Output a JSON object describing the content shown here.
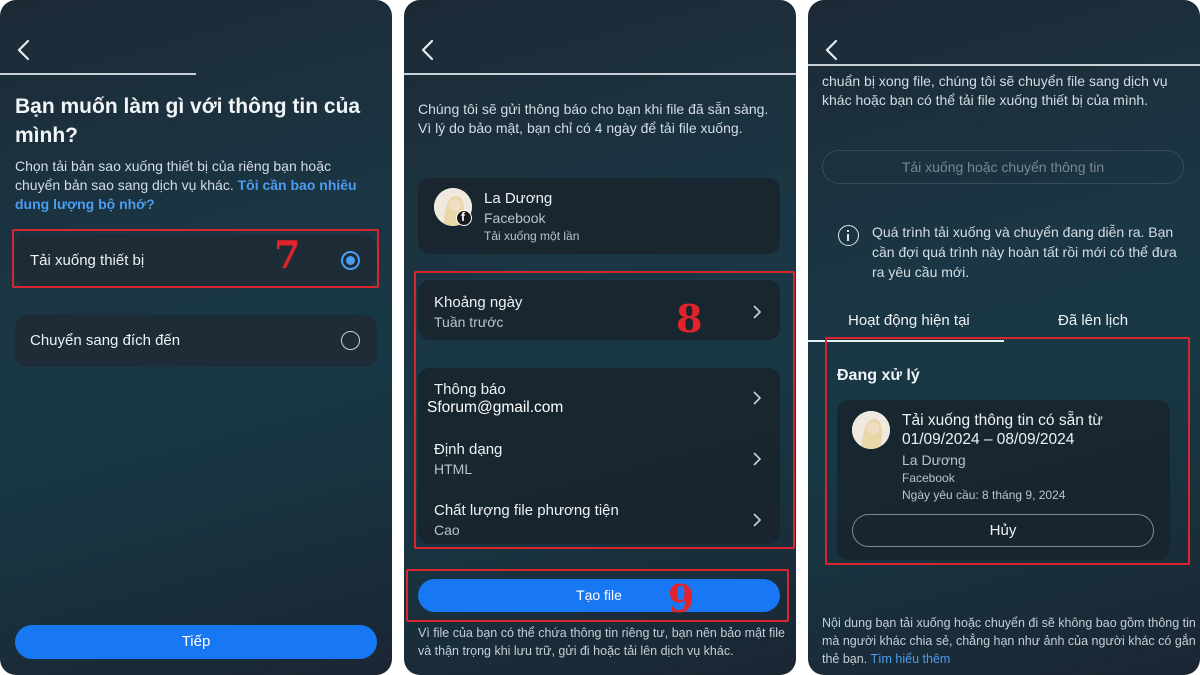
{
  "panel1": {
    "title": "Bạn muốn làm gì với thông tin của mình?",
    "description": "Chọn tải bản sao xuống thiết bị của riêng bạn hoặc chuyển bản sao sang dịch vụ khác.",
    "storage_link": "Tôi cần bao nhiêu dung lượng bộ nhớ?",
    "options": [
      {
        "label": "Tải xuống thiết bị",
        "selected": true
      },
      {
        "label": "Chuyển sang đích đến",
        "selected": false
      }
    ],
    "annotation": "7",
    "next_button": "Tiếp"
  },
  "panel2": {
    "intro": "Chúng tôi sẽ gửi thông báo cho bạn khi file đã sẵn sàng. Vì lý do bảo mật, bạn chỉ có 4 ngày để tải file xuống.",
    "profile": {
      "name": "La Dương",
      "platform": "Facebook",
      "type": "Tải xuống một lần"
    },
    "settings": [
      {
        "title": "Khoảng ngày",
        "value": "Tuần trước"
      },
      {
        "title": "Thông báo",
        "value": "Sforum@gmail.com"
      },
      {
        "title": "Định dạng",
        "value": "HTML"
      },
      {
        "title": "Chất lượng file phương tiện",
        "value": "Cao"
      }
    ],
    "annotation_settings": "8",
    "create_button": "Tạo file",
    "annotation_button": "9",
    "footer": "Vì file của bạn có thể chứa thông tin riêng tư, bạn nên bảo mật file và thận trọng khi lưu trữ, gửi đi hoặc tải lên dịch vụ khác."
  },
  "panel3": {
    "top_text": "chuẩn bị xong file, chúng tôi sẽ chuyển file sang dịch vụ khác hoặc bạn có thể tải file xuống thiết bị của mình.",
    "disabled_button": "Tải xuống hoặc chuyển thông tin",
    "info_text": "Quá trình tải xuống và chuyển đang diễn ra. Bạn cần đợi quá trình này hoàn tất rồi mới có thể đưa ra yêu cầu mới.",
    "tabs": [
      "Hoạt động hiện tại",
      "Đã lên lịch"
    ],
    "status": "Đang xử lý",
    "request": {
      "title_line1": "Tải xuống thông tin có sẵn từ",
      "title_line2": "01/09/2024 – 08/09/2024",
      "name": "La Dương",
      "platform": "Facebook",
      "date": "Ngày yêu cầu: 8 tháng 9, 2024"
    },
    "cancel_button": "Hủy",
    "footer": "Nội dung bạn tải xuống hoặc chuyển đi sẽ không bao gồm thông tin mà người khác chia sẻ, chẳng hạn như ảnh của người khác có gắn thẻ bạn.",
    "learn_more": "Tìm hiểu thêm"
  },
  "colors": {
    "accent": "#1877f2",
    "link": "#4a9df0",
    "annotation_red": "#d9262e"
  },
  "icons": [
    "back-arrow-icon",
    "radio-icon",
    "chevron-right-icon",
    "facebook-icon",
    "info-icon",
    "avatar-image"
  ]
}
